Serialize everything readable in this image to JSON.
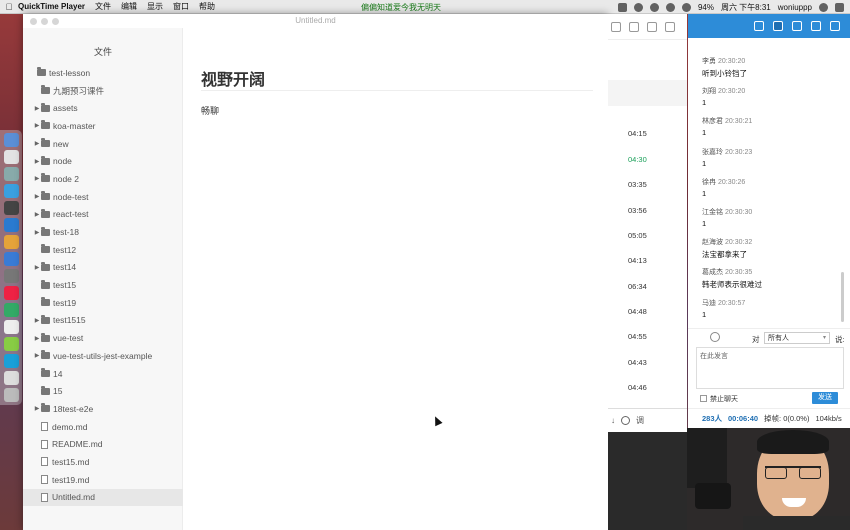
{
  "menubar": {
    "app_name": "QuickTime Player",
    "menu_items": [
      "文件",
      "编辑",
      "显示",
      "窗口",
      "帮助"
    ],
    "center_notice": "偏偏知道爱今我无明天",
    "battery": "94%",
    "datetime": "周六 下午8:31",
    "user": "woniuppp"
  },
  "typora": {
    "window_title": "Untitled.md",
    "sidebar_heading": "文件",
    "tree": [
      {
        "label": "test-lesson",
        "type": "folder",
        "depth": 0,
        "expandable": false
      },
      {
        "label": "九期预习课件",
        "type": "folder",
        "depth": 1,
        "expandable": false
      },
      {
        "label": "assets",
        "type": "folder",
        "depth": 1,
        "expandable": true
      },
      {
        "label": "koa-master",
        "type": "folder",
        "depth": 1,
        "expandable": true
      },
      {
        "label": "new",
        "type": "folder",
        "depth": 1,
        "expandable": true
      },
      {
        "label": "node",
        "type": "folder",
        "depth": 1,
        "expandable": true
      },
      {
        "label": "node 2",
        "type": "folder",
        "depth": 1,
        "expandable": true
      },
      {
        "label": "node-test",
        "type": "folder",
        "depth": 1,
        "expandable": true
      },
      {
        "label": "react-test",
        "type": "folder",
        "depth": 1,
        "expandable": true
      },
      {
        "label": "test-18",
        "type": "folder",
        "depth": 1,
        "expandable": true
      },
      {
        "label": "test12",
        "type": "folder",
        "depth": 1,
        "expandable": false
      },
      {
        "label": "test14",
        "type": "folder",
        "depth": 1,
        "expandable": true
      },
      {
        "label": "test15",
        "type": "folder",
        "depth": 1,
        "expandable": false
      },
      {
        "label": "test19",
        "type": "folder",
        "depth": 1,
        "expandable": false
      },
      {
        "label": "test1515",
        "type": "folder",
        "depth": 1,
        "expandable": true
      },
      {
        "label": "vue-test",
        "type": "folder",
        "depth": 1,
        "expandable": true
      },
      {
        "label": "vue-test-utils-jest-example",
        "type": "folder",
        "depth": 1,
        "expandable": true
      },
      {
        "label": "14",
        "type": "folder",
        "depth": 1,
        "expandable": false
      },
      {
        "label": "15",
        "type": "folder",
        "depth": 1,
        "expandable": false
      },
      {
        "label": "18test-e2e",
        "type": "folder",
        "depth": 1,
        "expandable": true
      },
      {
        "label": "demo.md",
        "type": "file",
        "depth": 1,
        "expandable": false
      },
      {
        "label": "README.md",
        "type": "file",
        "depth": 1,
        "expandable": false
      },
      {
        "label": "test15.md",
        "type": "file",
        "depth": 1,
        "expandable": false
      },
      {
        "label": "test19.md",
        "type": "file",
        "depth": 1,
        "expandable": false
      },
      {
        "label": "Untitled.md",
        "type": "file",
        "depth": 1,
        "expandable": false,
        "active": true
      }
    ],
    "doc": {
      "heading": "视野开阔",
      "paragraph": "畅聊"
    }
  },
  "video_list": {
    "durations": [
      "04:15",
      "04:30",
      "03:35",
      "03:56",
      "05:05",
      "04:13",
      "06:34",
      "04:48",
      "04:55",
      "04:43",
      "04:46"
    ],
    "active_index": 1,
    "bottom_label": "调"
  },
  "chat": {
    "messages": [
      {
        "name": "李勇",
        "time": "20:30:20",
        "text": "听到小铃铛了"
      },
      {
        "name": "刘翔",
        "time": "20:30:20",
        "text": "1"
      },
      {
        "name": "林彦君",
        "time": "20:30:21",
        "text": "1"
      },
      {
        "name": "张嘉玲",
        "time": "20:30:23",
        "text": "1"
      },
      {
        "name": "徐冉",
        "time": "20:30:26",
        "text": "1"
      },
      {
        "name": "江金铭",
        "time": "20:30:30",
        "text": "1"
      },
      {
        "name": "赵海波",
        "time": "20:30:32",
        "text": "法宝都拿来了"
      },
      {
        "name": "葛成杰",
        "time": "20:30:35",
        "text": "韩老师表示很难过"
      },
      {
        "name": "马迪",
        "time": "20:30:57",
        "text": "1"
      }
    ],
    "to_label": "对",
    "target": "所有人",
    "say_label": "说:",
    "input_placeholder": "在此发言",
    "ban_label": "禁止聊天",
    "send_label": "发送",
    "footer": {
      "online_count": "283人",
      "duration": "00:06:40",
      "drop_rate": "掉帧: 0(0.0%)",
      "bitrate": "104kb/s"
    }
  },
  "colors": {
    "accent": "#2d8cd8",
    "active_duration": "#1ba05a"
  }
}
